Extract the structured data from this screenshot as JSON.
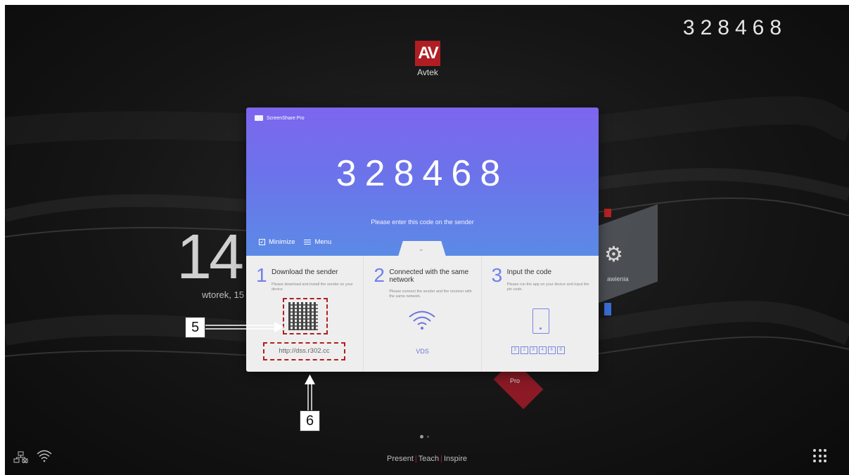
{
  "screen": {
    "corner_code": "328468",
    "logo": {
      "mark": "AV",
      "name": "Avtek"
    },
    "clock_big": "14",
    "clock_date": "wtorek, 15",
    "bg_tile_label": "awienia",
    "bg_tile_red_label": "Pro",
    "page_dots": {
      "count": 2,
      "active": 0
    },
    "tagline": [
      "Present",
      "Teach",
      "Inspire"
    ],
    "colors": {
      "accent_red": "#b01e24",
      "dialog_gradient_top": "#7c66ee",
      "dialog_gradient_bottom": "#5b8ae6"
    }
  },
  "dialog": {
    "app_title": "ScreenShare Pro",
    "code": "328468",
    "instruction": "Please enter this code on the sender",
    "minimize_label": "Minimize",
    "menu_label": "Menu",
    "steps": [
      {
        "number": "1",
        "title": "Download the sender",
        "desc": "Please download and install the sender on your device",
        "url": "http://dss.r302.cc"
      },
      {
        "number": "2",
        "title": "Connected with the same network",
        "desc": "Please connect the sender and the receiver with the same network.",
        "network": "VDS"
      },
      {
        "number": "3",
        "title": "Input the code",
        "desc": "Please run the app on your device and input the pin code.",
        "pin": [
          "3",
          "2",
          "8",
          "4",
          "6",
          "8"
        ]
      }
    ]
  },
  "callouts": {
    "five": "5",
    "six": "6"
  },
  "icons": {
    "network": "network-disconnected-icon",
    "wifi": "wifi-icon",
    "apps": "apps-grid-icon",
    "settings": "gear-icon"
  }
}
